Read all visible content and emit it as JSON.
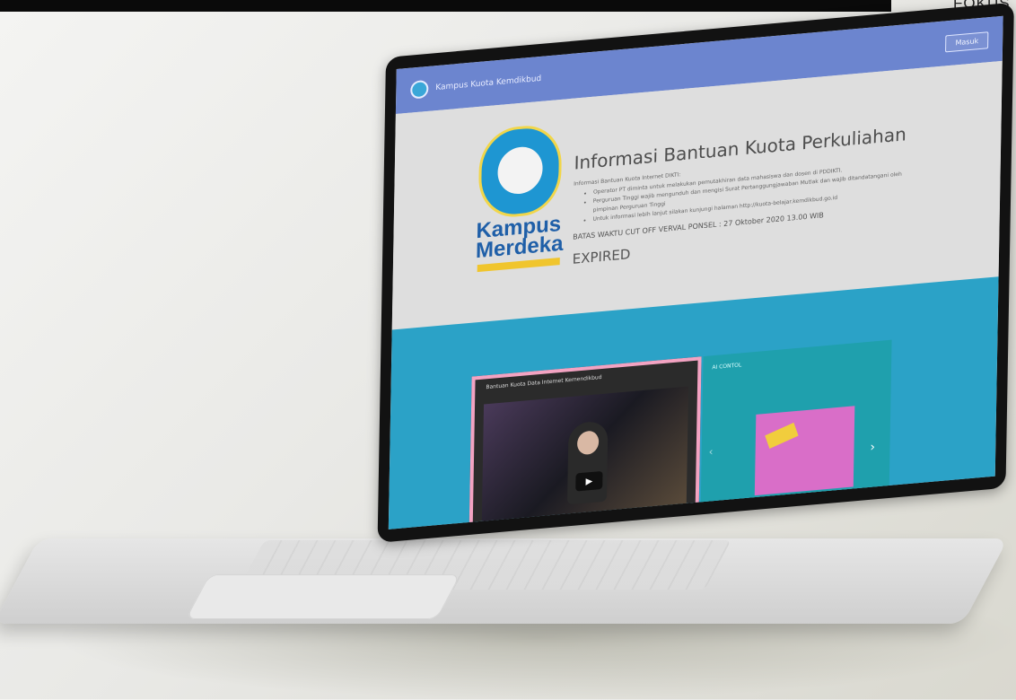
{
  "corner_label": "FOKUS",
  "site": {
    "nav": {
      "title": "Kampus Kuota Kemdikbud",
      "button": "Masuk"
    },
    "hero": {
      "title": "Informasi Bantuan Kuota Perkuliahan",
      "intro": "Informasi Bantuan Kuota Internet DIKTI:",
      "bullets": [
        "Operator PT diminta untuk melakukan pemutakhiran data mahasiswa dan dosen di PDDIKTI.",
        "Perguruan Tinggi wajib mengunduh dan mengisi Surat Pertanggungjawaban Mutlak dan wajib ditandatangani oleh pimpinan Perguruan Tinggi",
        "Untuk informasi lebih lanjut silakan kunjungi halaman http://kuota-belajar.kemdikbud.go.id"
      ],
      "deadline": "BATAS WAKTU CUT OFF VERVAL PONSEL : 27 Oktober 2020 13.00 WIB",
      "status": "EXPIRED",
      "logo_text_1": "Kampus",
      "logo_text_2": "Merdeka"
    },
    "video": {
      "title": "Bantuan Kuota Data Internet Kemendikbud"
    },
    "slide": {
      "label": "AI CONTOL"
    }
  }
}
